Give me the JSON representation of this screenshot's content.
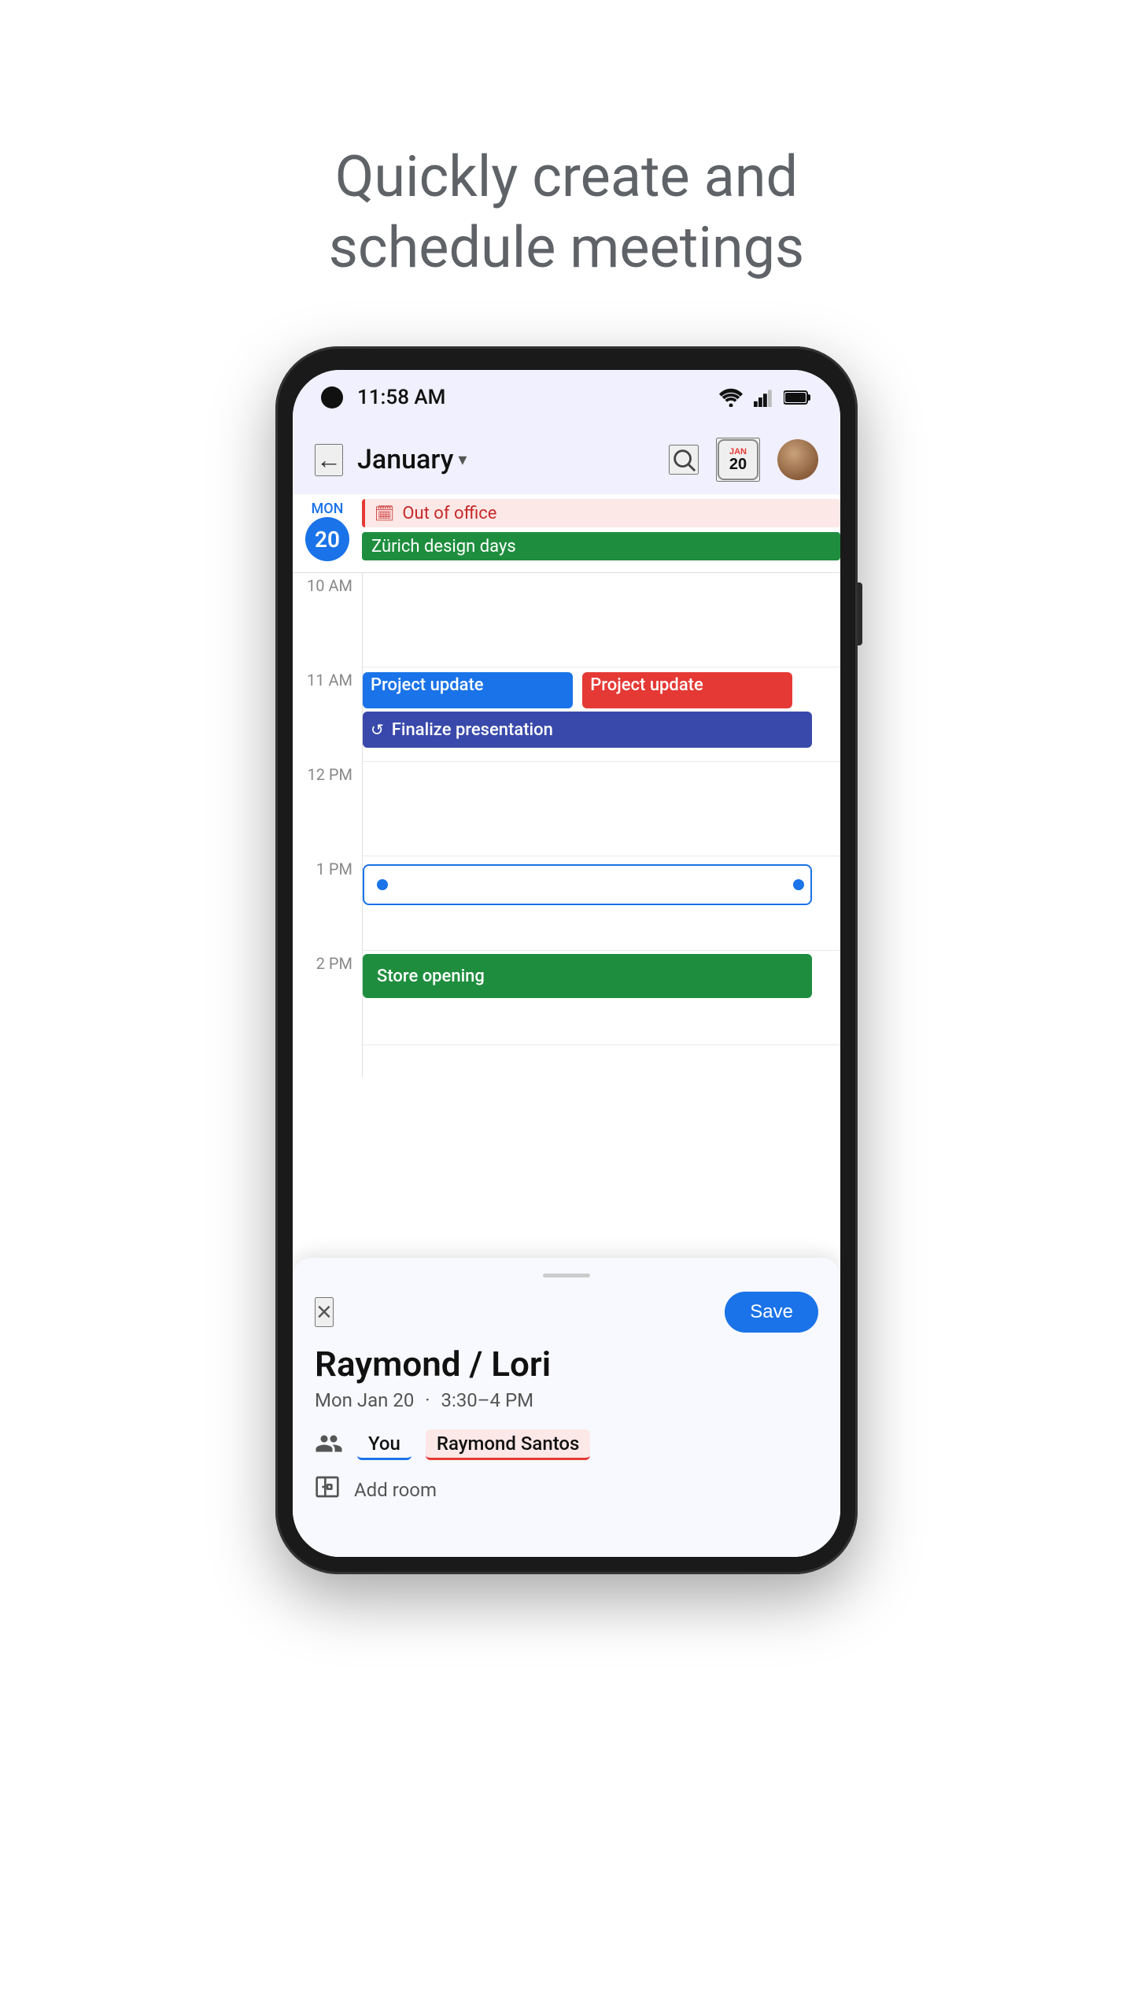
{
  "headline": "Quickly create and\nschedule meetings",
  "status": {
    "time": "11:58 AM"
  },
  "header": {
    "month": "January",
    "back_label": "←",
    "today_label": "20",
    "today_month_label": "jan"
  },
  "allday": {
    "out_of_office": "Out of office",
    "zurich": "Zürich design days"
  },
  "time_labels": [
    "10 AM",
    "11 AM",
    "12 PM",
    "1 PM",
    "2 PM"
  ],
  "events": {
    "project_blue": "Project update",
    "project_red": "Project update",
    "finalize": "Finalize presentation",
    "store": "Store opening"
  },
  "date": {
    "day": "Mon",
    "num": "20"
  },
  "sheet": {
    "title": "Raymond / Lori",
    "date": "Mon Jan 20",
    "time": "3:30–4 PM",
    "save_label": "Save",
    "close_label": "×",
    "attendees": [
      "You",
      "Raymond Santos"
    ],
    "add_room": "Add room"
  }
}
